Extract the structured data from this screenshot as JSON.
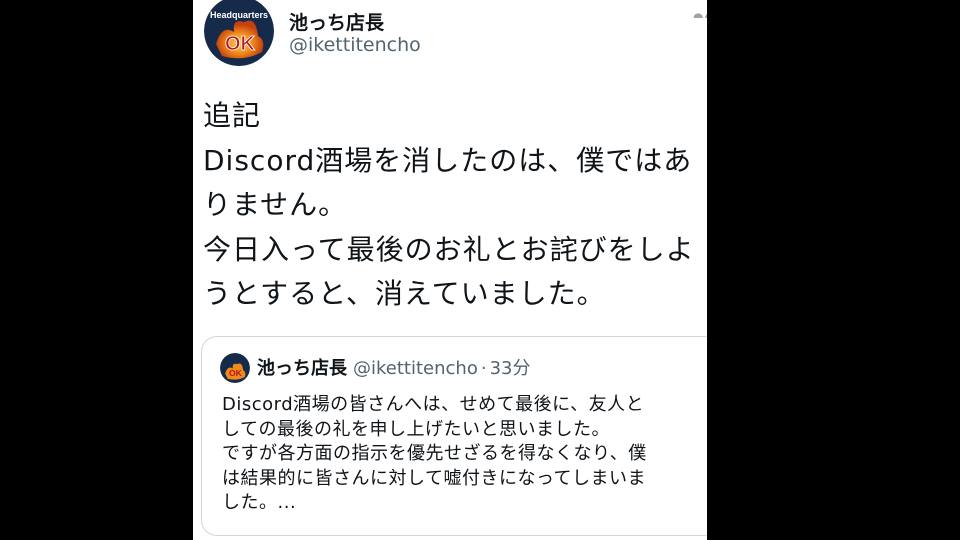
{
  "author": {
    "name": "池っち店長",
    "handle": "@ikettitencho",
    "avatar_text": "Headquarters",
    "avatar_logo": "OK"
  },
  "tweet": {
    "text": "追記\nDiscord酒場を消したのは、僕ではあ\nりません。\n今日入って最後のお礼とお詫びをしよ\nうとすると、消えていました。"
  },
  "quote": {
    "name": "池っち店長",
    "handle": "@ikettitencho",
    "separator": "·",
    "time": "33分",
    "text": "Discord酒場の皆さんへは、せめて最後に、友人と\nしての最後の礼を申し上げたいと思いました。\nですが各方面の指示を優先せざるを得なくなり、僕\nは結果的に皆さんに対して嘘付きになってしまいま\nした。..."
  },
  "icons": {
    "more": "more-horizontal-icon"
  },
  "colors": {
    "text": "#0f1419",
    "secondary": "#536471",
    "border": "#cfd9de",
    "background": "#ffffff"
  }
}
